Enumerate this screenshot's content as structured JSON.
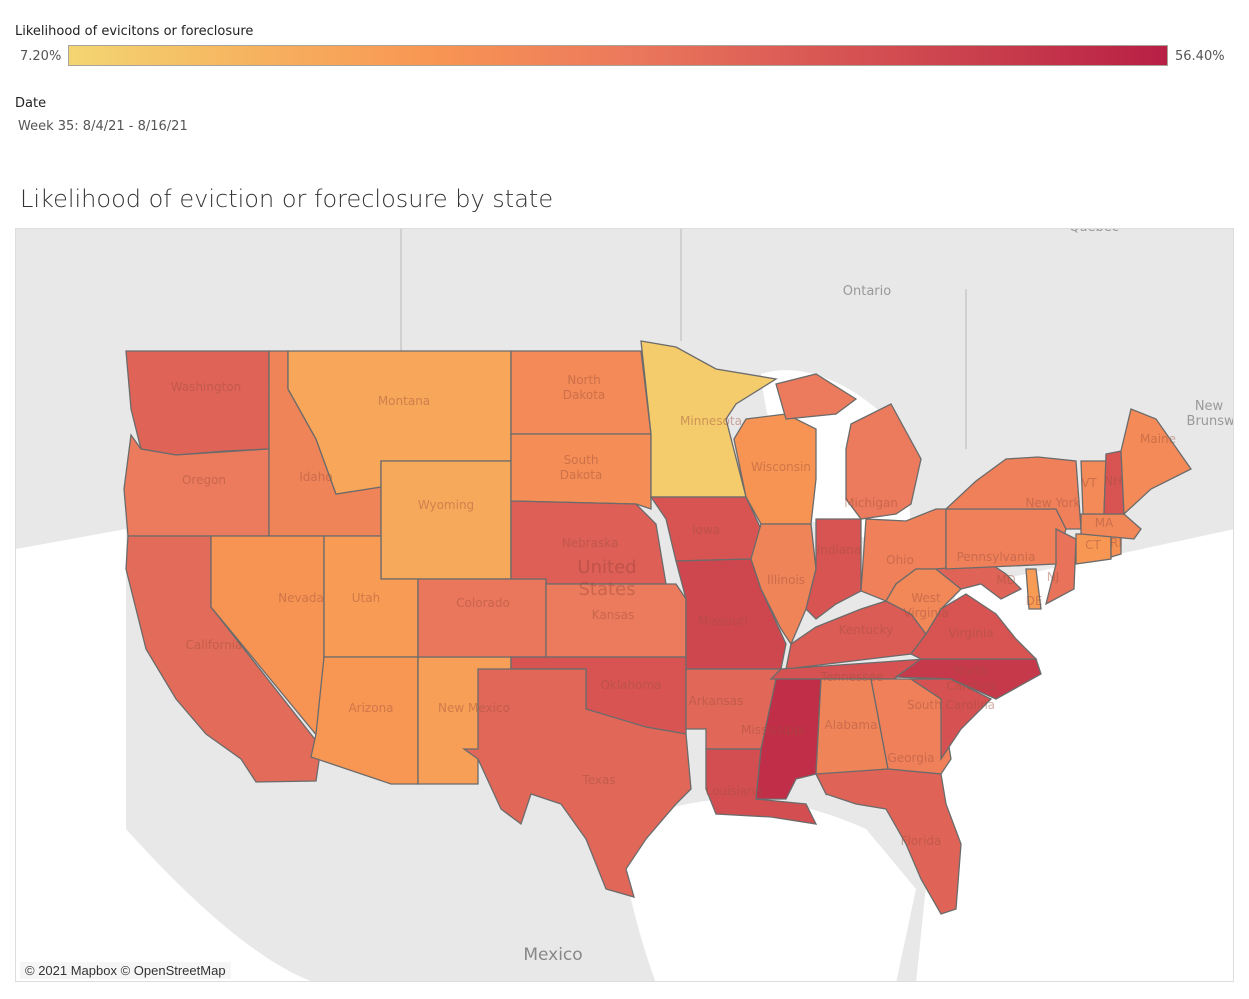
{
  "legend": {
    "title": "Likelihood of evicitons or foreclosure",
    "min_label": "7.20%",
    "max_label": "56.40%",
    "min_value": 7.2,
    "max_value": 56.4,
    "color_stops": [
      "#f3d672",
      "#f6b35f",
      "#f89553",
      "#ec7a5c",
      "#da5a55",
      "#c93e4c",
      "#b81f45"
    ]
  },
  "filter": {
    "title": "Date",
    "value": "Week 35: 8/4/21 - 8/16/21"
  },
  "map": {
    "title": "Likelihood of eviction or foreclosure by state",
    "attribution": "© 2021 Mapbox © OpenStreetMap",
    "base_labels": [
      {
        "name": "country-label-us-line1",
        "text": "United"
      },
      {
        "name": "country-label-us-line2",
        "text": "States"
      },
      {
        "name": "country-label-mexico",
        "text": "Mexico"
      },
      {
        "name": "region-label-ontario",
        "text": "Ontario"
      },
      {
        "name": "region-label-quebec",
        "text": "Quebec"
      },
      {
        "name": "region-label-new-brunswick-line1",
        "text": "New"
      },
      {
        "name": "region-label-new-brunswick-line2",
        "text": "Brunswic"
      }
    ],
    "states": [
      {
        "name": "Washington",
        "label": "Washington",
        "level": 0.62
      },
      {
        "name": "Oregon",
        "label": "Oregon",
        "level": 0.5
      },
      {
        "name": "California",
        "label": "California",
        "level": 0.58
      },
      {
        "name": "Idaho",
        "label": "Idaho",
        "level": 0.44
      },
      {
        "name": "Nevada",
        "label": "Nevada",
        "level": 0.34
      },
      {
        "name": "Montana",
        "label": "Montana",
        "level": 0.24
      },
      {
        "name": "Wyoming",
        "label": "Wyoming",
        "level": 0.22
      },
      {
        "name": "Utah",
        "label": "Utah",
        "level": 0.3
      },
      {
        "name": "Arizona",
        "label": "Arizona",
        "level": 0.32
      },
      {
        "name": "New Mexico",
        "label": "New Mexico",
        "level": 0.28
      },
      {
        "name": "Colorado",
        "label": "Colorado",
        "level": 0.52
      },
      {
        "name": "North Dakota",
        "label": "North Dakota",
        "level": 0.4
      },
      {
        "name": "South Dakota",
        "label": "South Dakota",
        "level": 0.38
      },
      {
        "name": "Nebraska",
        "label": "Nebraska",
        "level": 0.64
      },
      {
        "name": "Kansas",
        "label": "Kansas",
        "level": 0.5
      },
      {
        "name": "Oklahoma",
        "label": "Oklahoma",
        "level": 0.7
      },
      {
        "name": "Texas",
        "label": "Texas",
        "level": 0.6
      },
      {
        "name": "Minnesota",
        "label": "Minnesota",
        "level": 0.05
      },
      {
        "name": "Iowa",
        "label": "Iowa",
        "level": 0.7
      },
      {
        "name": "Missouri",
        "label": "Missouri",
        "level": 0.78
      },
      {
        "name": "Arkansas",
        "label": "Arkansas",
        "level": 0.6
      },
      {
        "name": "Louisiana",
        "label": "Louisiana",
        "level": 0.74
      },
      {
        "name": "Wisconsin",
        "label": "Wisconsin",
        "level": 0.34
      },
      {
        "name": "Illinois",
        "label": "Illinois",
        "level": 0.44
      },
      {
        "name": "Michigan",
        "label": "Michigan",
        "level": 0.5
      },
      {
        "name": "Indiana",
        "label": "Indiana",
        "level": 0.7
      },
      {
        "name": "Ohio",
        "label": "Ohio",
        "level": 0.46
      },
      {
        "name": "Kentucky",
        "label": "Kentucky",
        "level": 0.66
      },
      {
        "name": "Tennessee",
        "label": "Tennessee",
        "level": 0.72
      },
      {
        "name": "Mississippi",
        "label": "Mississippi",
        "level": 0.92
      },
      {
        "name": "Alabama",
        "label": "Alabama",
        "level": 0.44
      },
      {
        "name": "Georgia",
        "label": "Georgia",
        "level": 0.46
      },
      {
        "name": "Florida",
        "label": "Florida",
        "level": 0.62
      },
      {
        "name": "South Carolina",
        "label": "South Carolina",
        "level": 0.72
      },
      {
        "name": "North Carolina",
        "label": "North Carolina",
        "level": 0.86
      },
      {
        "name": "Virginia",
        "label": "Virginia",
        "level": 0.7
      },
      {
        "name": "West Virginia",
        "label": "West Virginia",
        "level": 0.42
      },
      {
        "name": "Maryland",
        "label": "MD",
        "level": 0.62
      },
      {
        "name": "Delaware",
        "label": "DE",
        "level": 0.3
      },
      {
        "name": "Pennsylvania",
        "label": "Pennsylvania",
        "level": 0.46
      },
      {
        "name": "New Jersey",
        "label": "NJ",
        "level": 0.54
      },
      {
        "name": "New York",
        "label": "New York",
        "level": 0.46
      },
      {
        "name": "Connecticut",
        "label": "CT",
        "level": 0.32
      },
      {
        "name": "Rhode Island",
        "label": "RI",
        "level": 0.36
      },
      {
        "name": "Massachusetts",
        "label": "MA",
        "level": 0.42
      },
      {
        "name": "Vermont",
        "label": "VT",
        "level": 0.4
      },
      {
        "name": "New Hampshire",
        "label": "NH",
        "level": 0.7
      },
      {
        "name": "Maine",
        "label": "Maine",
        "level": 0.4
      }
    ]
  }
}
